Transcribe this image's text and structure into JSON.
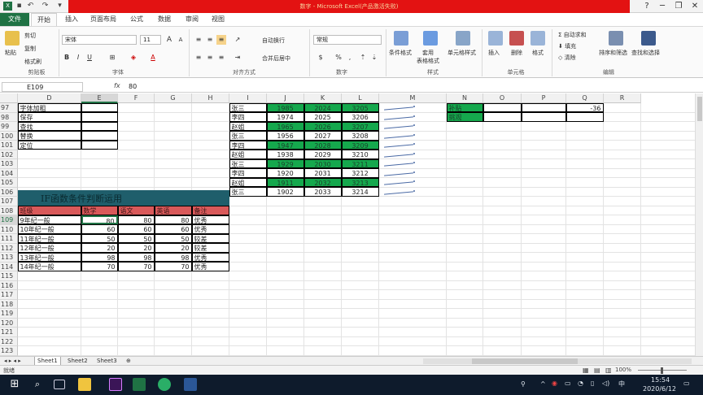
{
  "window": {
    "title": "数字 - Microsoft Excel(产品激活失败)",
    "min": "─",
    "restore": "❐",
    "close": "✕",
    "help": "?"
  },
  "tabs": [
    "文件",
    "开始",
    "插入",
    "页面布局",
    "公式",
    "数据",
    "审阅",
    "视图"
  ],
  "ribbon": {
    "clipboard": {
      "paste": "粘贴",
      "cut": "剪切",
      "copy": "复制",
      "painter": "格式刷",
      "label": "剪贴板"
    },
    "font": {
      "name": "宋体",
      "size": "11",
      "bold": "B",
      "italic": "I",
      "underline": "U",
      "label": "字体",
      "grow": "A",
      "shrink": "A",
      "color_letter": "A"
    },
    "align": {
      "wrap": "自动换行",
      "merge": "合并后居中",
      "label": "对齐方式"
    },
    "number": {
      "format": "常规",
      "label": "数字",
      "pct": "%",
      "comma": ","
    },
    "styles": {
      "cond": "条件格式",
      "table": "套用\n表格格式",
      "cell": "单元格样式",
      "label": "样式"
    },
    "cells": {
      "insert": "插入",
      "delete": "删除",
      "format": "格式",
      "label": "单元格"
    },
    "edit": {
      "sum": "自动求和",
      "fill": "填充",
      "clear": "清除",
      "sort": "排序和筛选",
      "find": "查找和选择",
      "label": "编辑"
    }
  },
  "formula": {
    "namebox": "E109",
    "fx": "fx",
    "value": "80"
  },
  "columns": [
    "D",
    "E",
    "F",
    "G",
    "H",
    "I",
    "J",
    "K",
    "L",
    "M",
    "N",
    "O",
    "P",
    "Q",
    "R"
  ],
  "rows": [
    "97",
    "98",
    "99",
    "100",
    "101",
    "102",
    "103",
    "104",
    "105",
    "106",
    "107",
    "108",
    "109",
    "110",
    "111",
    "112",
    "113",
    "114",
    "115",
    "116",
    "117",
    "118",
    "119",
    "120",
    "121",
    "122",
    "123"
  ],
  "d_list": [
    "字体加粗",
    "保存",
    "查找",
    "替换",
    "定位"
  ],
  "ijkl": [
    [
      "张三",
      "1985",
      "2024",
      "3205"
    ],
    [
      "李四",
      "1974",
      "2025",
      "3206"
    ],
    [
      "赵姐",
      "1965",
      "2026",
      "3207"
    ],
    [
      "张三",
      "1956",
      "2027",
      "3208"
    ],
    [
      "李四",
      "1947",
      "2028",
      "3209"
    ],
    [
      "赵姐",
      "1938",
      "2029",
      "3210"
    ],
    [
      "张三",
      "1929",
      "2030",
      "3211"
    ],
    [
      "李四",
      "1920",
      "2031",
      "3212"
    ],
    [
      "赵姐",
      "1911",
      "2032",
      "3213"
    ],
    [
      "张三",
      "1902",
      "2033",
      "3214"
    ]
  ],
  "green_rows": [
    0,
    2,
    4,
    6,
    8
  ],
  "n_list": [
    "补贴",
    "挑观"
  ],
  "q_val": "-36",
  "banner": "IF函数条件判断运用",
  "table_head": [
    "班级",
    "数学",
    "语文",
    "英语",
    "备注"
  ],
  "table_rows": [
    [
      "9年纪一般",
      "80",
      "80",
      "80",
      "优秀"
    ],
    [
      "10年纪一般",
      "60",
      "60",
      "60",
      "优秀"
    ],
    [
      "11年纪一般",
      "50",
      "50",
      "50",
      "较差"
    ],
    [
      "12年纪一般",
      "20",
      "20",
      "20",
      "较差"
    ],
    [
      "13年纪一般",
      "98",
      "98",
      "98",
      "优秀"
    ],
    [
      "14年纪一般",
      "70",
      "70",
      "70",
      "优秀"
    ]
  ],
  "sheets": [
    "Sheet1",
    "Sheet2",
    "Sheet3"
  ],
  "status": {
    "ready": "就绪",
    "zoom": "100%"
  },
  "clock": {
    "time": "15:54",
    "date": "2020/6/12"
  },
  "tray": {
    "lang": "中"
  },
  "colors": {
    "excel_green": "#1f7244",
    "title_red": "#e31212",
    "cell_green": "#15a84d",
    "banner": "#1f5e6b",
    "head_red": "#d9595a"
  }
}
